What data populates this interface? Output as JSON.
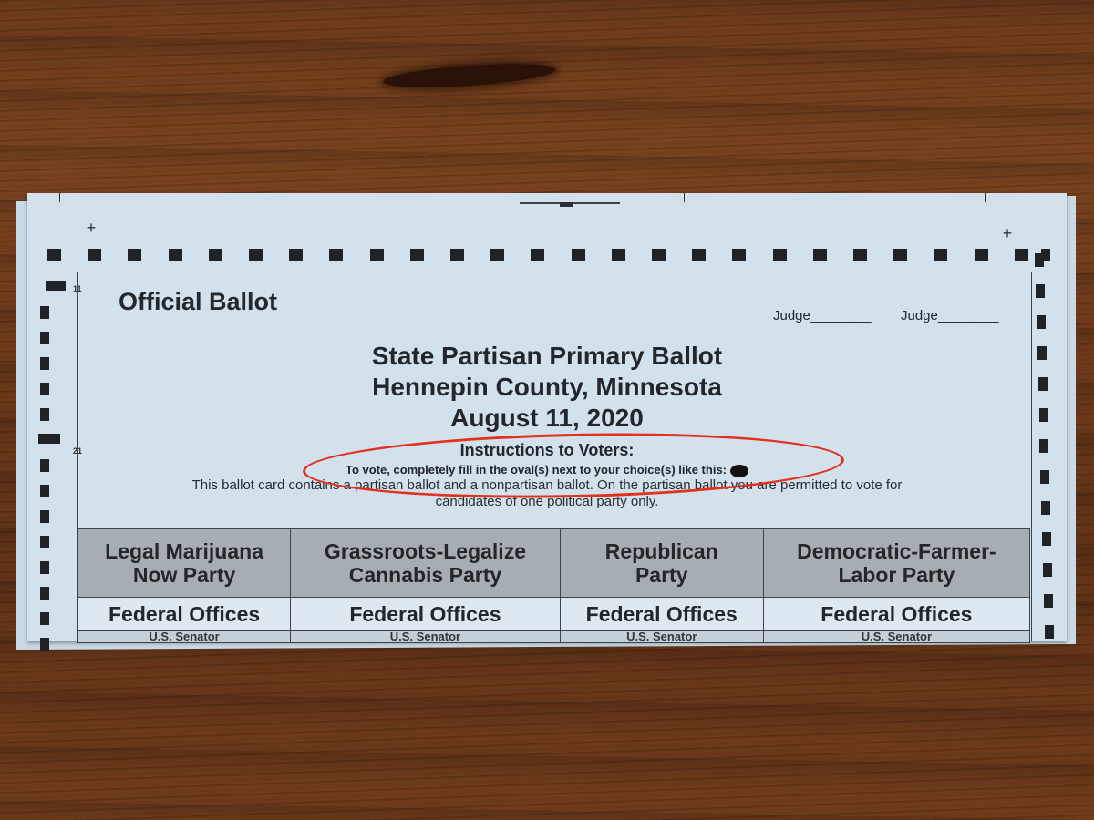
{
  "scene": {
    "description": "Photograph of a folded Minnesota primary ballot on a wooden table",
    "colors": {
      "paper": "#d2e1ec",
      "annotation": "#e2311c",
      "party_header_bg": "#a6aeb4",
      "wood": "#6b3a1c"
    }
  },
  "ballot": {
    "margin_numbers": [
      "11",
      "21"
    ],
    "official_label": "Official Ballot",
    "judge_labels": [
      "Judge________",
      "Judge________"
    ],
    "title_lines": [
      "State Partisan Primary Ballot",
      "Hennepin County, Minnesota",
      "August 11, 2020"
    ],
    "instructions": {
      "heading": "Instructions to Voters:",
      "text": "To vote, completely fill in the oval(s) next to your choice(s) like this:",
      "example_icon": "filled-oval-icon"
    },
    "body_text": [
      "This ballot card contains a partisan ballot and a nonpartisan ballot. On the partisan ballot you are permitted to vote for",
      "candidates of one political party only."
    ],
    "parties": [
      {
        "name": "Legal Marijuana Now Party",
        "line1": "Legal Marijuana",
        "line2": "Now Party",
        "section": "Federal Offices",
        "office": "U.S. Senator"
      },
      {
        "name": "Grassroots-Legalize Cannabis Party",
        "line1": "Grassroots-Legalize",
        "line2": "Cannabis Party",
        "section": "Federal Offices",
        "office": "U.S. Senator"
      },
      {
        "name": "Republican Party",
        "line1": "Republican",
        "line2": "Party",
        "section": "Federal Offices",
        "office": "U.S. Senator"
      },
      {
        "name": "Democratic-Farmer-Labor Party",
        "line1": "Democratic-Farmer-",
        "line2": "Labor Party",
        "section": "Federal Offices",
        "office": "U.S. Senator"
      }
    ]
  },
  "annotation": {
    "type": "red-ellipse",
    "highlights": "instructions"
  }
}
